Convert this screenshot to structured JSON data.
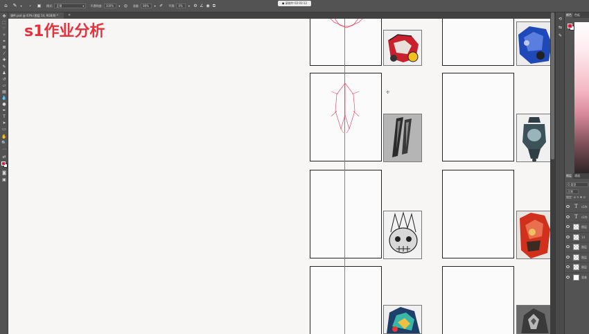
{
  "options_bar": {
    "mode_label": "模式:",
    "mode_value": "正常",
    "opacity_label": "不透明度:",
    "opacity_value": "100%",
    "flow_label": "流量:",
    "flow_value": "80%",
    "smoothing_label": "平滑:",
    "smoothing_value": "0%"
  },
  "recording_badge": "● 录制中 02:03:12",
  "document_tab": {
    "title": "课件.psd @ 43% (图层 14, RGB/8) *",
    "close": "×"
  },
  "canvas": {
    "heading": "s1作业分析",
    "accent": "#e8303c",
    "guide_color": "#3b8ee0"
  },
  "panels": {
    "color_tabs": [
      "颜色",
      "色板"
    ],
    "layers_tabs": [
      "图层",
      "通道"
    ],
    "layer_filter": "Q 类型",
    "layer_mode": "正常",
    "lock_label": "锁定: ⊘ ✎ ✥ ⊡",
    "layers": [
      {
        "kind": "text",
        "name": "s1作"
      },
      {
        "kind": "text",
        "name": "s1作"
      },
      {
        "kind": "pixel",
        "name": "图层"
      },
      {
        "kind": "pixel",
        "name": "14"
      },
      {
        "kind": "pixel",
        "name": "图层"
      },
      {
        "kind": "pixel",
        "name": "图层"
      },
      {
        "kind": "pixel",
        "name": "图层"
      },
      {
        "kind": "white",
        "name": "背景"
      }
    ],
    "foreground_color": "#e3152f",
    "background_color": "#ffffff"
  },
  "icons": {
    "home": "home-icon",
    "brush": "brush-icon",
    "pressure": "pressure-icon",
    "angle": "angle-icon",
    "symmetry": "symmetry-icon"
  }
}
